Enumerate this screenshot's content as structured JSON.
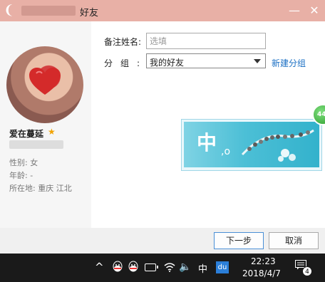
{
  "window": {
    "title": "好友",
    "minimize_label": "—",
    "close_label": "✕"
  },
  "profile": {
    "nickname": "爱在蔓延",
    "gender": "性别: 女",
    "age": "年龄:  -",
    "location": "所在地: 重庆  江北"
  },
  "form": {
    "remark_label": "备注姓名:",
    "remark_placeholder": "选填",
    "remark_value": "",
    "group_label": "分组:",
    "group_value": "我的好友",
    "new_group_link": "新建分组"
  },
  "ad": {
    "char": "中",
    "dots": ",o"
  },
  "badge": {
    "count": "44"
  },
  "footer": {
    "next_label": "下一步",
    "cancel_label": "取消"
  },
  "taskbar": {
    "ime": "中",
    "du": "du",
    "time": "22:23",
    "date": "2018/4/7",
    "notifications": "4"
  },
  "colors": {
    "titlebar": "#e8b0a6",
    "link": "#1a6fc4",
    "primary_button_border": "#4a8fd6",
    "taskbar": "#1a1a1a"
  }
}
